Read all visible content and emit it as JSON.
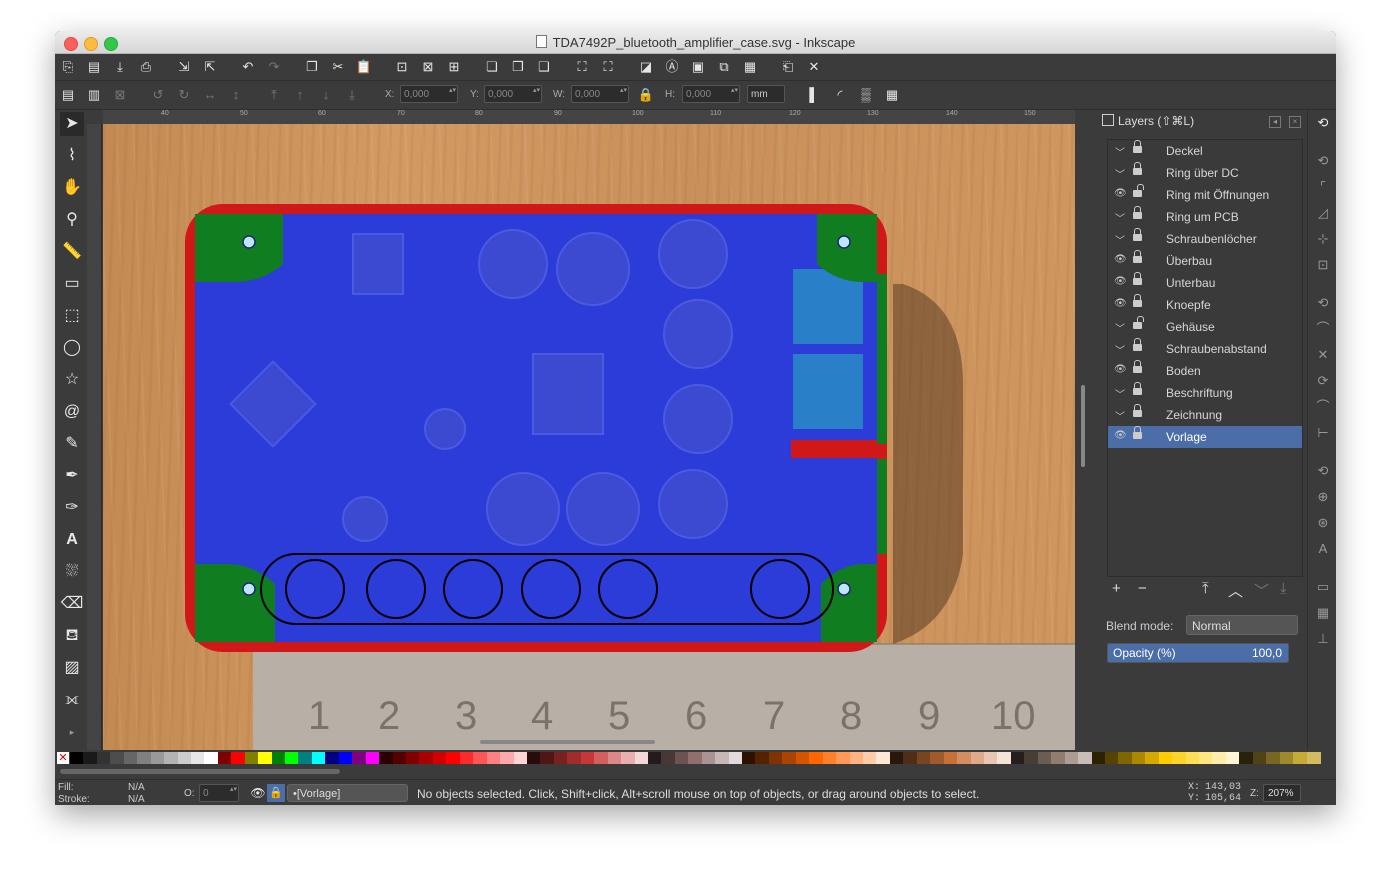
{
  "window": {
    "title": "TDA7492P_bluetooth_amplifier_case.svg - Inkscape"
  },
  "toolbar": {
    "x_label": "X:",
    "x_value": "0,000",
    "y_label": "Y:",
    "y_value": "0,000",
    "w_label": "W:",
    "w_value": "0,000",
    "h_label": "H:",
    "h_value": "0,000",
    "unit": "mm"
  },
  "ruler": {
    "h_ticks": [
      "40",
      "50",
      "60",
      "70",
      "80",
      "90",
      "100",
      "110",
      "120",
      "130",
      "140",
      "150"
    ]
  },
  "tools": [
    "selector-tool",
    "node-tool",
    "tweak-tool",
    "zoom-tool",
    "measure-tool",
    "rect-tool",
    "3dbox-tool",
    "ellipse-tool",
    "star-tool",
    "spiral-tool",
    "pencil-tool",
    "pen-tool",
    "calligraphy-tool",
    "text-tool",
    "spray-tool",
    "eraser-tool",
    "paint-bucket-tool",
    "gradient-tool",
    "connector-tool"
  ],
  "canvas": {
    "ruler_numbers": [
      "1",
      "2",
      "3",
      "4",
      "5",
      "6",
      "7",
      "8",
      "9",
      "10"
    ],
    "colors": {
      "case_outline": "#d01818",
      "pcb_overlay": "#2b3cd8",
      "corner": "#0f7d20",
      "hole": "#bfe6ff"
    }
  },
  "layers_panel": {
    "title": "Layers (⇧⌘L)",
    "layers": [
      {
        "name": "Deckel",
        "visible": false,
        "locked": true
      },
      {
        "name": "Ring über DC",
        "visible": false,
        "locked": true
      },
      {
        "name": "Ring mit Öffnungen",
        "visible": true,
        "locked": false
      },
      {
        "name": "Ring um PCB",
        "visible": false,
        "locked": true
      },
      {
        "name": "Schraubenlöcher",
        "visible": false,
        "locked": true
      },
      {
        "name": "Überbau",
        "visible": true,
        "locked": true
      },
      {
        "name": "Unterbau",
        "visible": true,
        "locked": true
      },
      {
        "name": "Knoepfe",
        "visible": true,
        "locked": true
      },
      {
        "name": "Gehäuse",
        "visible": false,
        "locked": false
      },
      {
        "name": "Schraubenabstand",
        "visible": false,
        "locked": true
      },
      {
        "name": "Boden",
        "visible": true,
        "locked": true
      },
      {
        "name": "Beschriftung",
        "visible": false,
        "locked": true
      },
      {
        "name": "Zeichnung",
        "visible": false,
        "locked": true
      },
      {
        "name": "Vorlage",
        "visible": true,
        "locked": true,
        "selected": true
      }
    ],
    "blend_label": "Blend mode:",
    "blend_value": "Normal",
    "opacity_label": "Opacity (%)",
    "opacity_value": "100,0",
    "opacity_fraction": 1.0
  },
  "status": {
    "fill_label": "Fill:",
    "fill_value": "N/A",
    "stroke_label": "Stroke:",
    "stroke_value": "N/A",
    "opacity_label": "O:",
    "opacity_value": "0",
    "current_layer": "•[Vorlage]",
    "message": "No objects selected. Click, Shift+click, Alt+scroll mouse on top of objects, or drag around objects to select.",
    "cursor_x_label": "X:",
    "cursor_x": "143,03",
    "cursor_y_label": "Y:",
    "cursor_y": "105,64",
    "zoom_label": "Z:",
    "zoom_value": "207%"
  },
  "palette": [
    "#000000",
    "#1a1a1a",
    "#333333",
    "#4d4d4d",
    "#666666",
    "#808080",
    "#999999",
    "#b3b3b3",
    "#cccccc",
    "#e6e6e6",
    "#ffffff",
    "#800000",
    "#ff0000",
    "#808000",
    "#ffff00",
    "#008000",
    "#00ff00",
    "#008080",
    "#00ffff",
    "#000080",
    "#0000ff",
    "#800080",
    "#ff00ff",
    "#2b0000",
    "#550000",
    "#800000",
    "#aa0000",
    "#d40000",
    "#ff0000",
    "#ff2a2a",
    "#ff5555",
    "#ff8080",
    "#ffaaaa",
    "#ffd5d5",
    "#280b0b",
    "#501616",
    "#782121",
    "#a02c2c",
    "#c83737",
    "#d35f5f",
    "#de8787",
    "#e9afaf",
    "#f4d7d7",
    "#241c1c",
    "#483737",
    "#6c5353",
    "#916f6f",
    "#ac9393",
    "#c8b7b7",
    "#e3dbdb",
    "#2b1100",
    "#552200",
    "#803300",
    "#aa4400",
    "#d45500",
    "#ff6600",
    "#ff7f2a",
    "#ff9955",
    "#ffb380",
    "#ffccaa",
    "#ffe6d5",
    "#28170b",
    "#502d16",
    "#784421",
    "#a05a2c",
    "#c87137",
    "#d38d5f",
    "#deaa87",
    "#e9c6af",
    "#f4e3d7",
    "#241f1c",
    "#483e37",
    "#6c5d53",
    "#917c6f",
    "#ac9d93",
    "#c8beb7",
    "#2b2200",
    "#554400",
    "#806600",
    "#aa8800",
    "#d4aa00",
    "#ffcc00",
    "#ffd42a",
    "#ffdd55",
    "#ffe680",
    "#ffeeaa",
    "#fff6d5",
    "#28220b",
    "#504416",
    "#786721",
    "#a0892c",
    "#c8ab37",
    "#d3bc5f"
  ]
}
